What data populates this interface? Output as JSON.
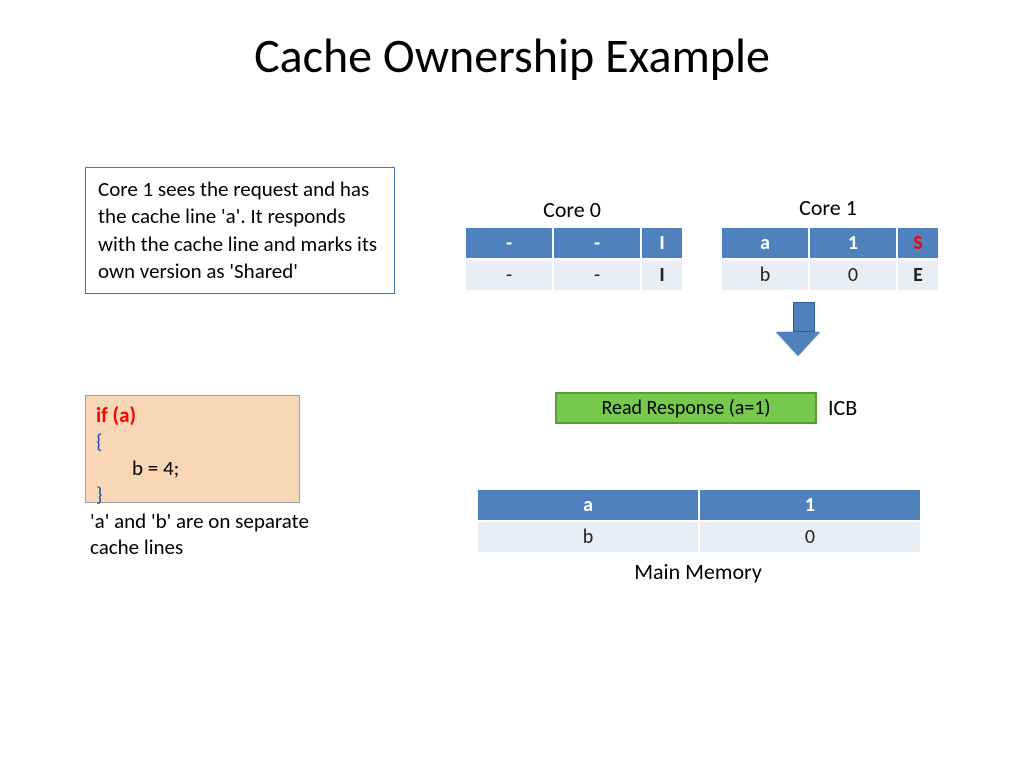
{
  "title": "Cache Ownership Example",
  "description": "Core 1 sees the request and has the cache line 'a'. It responds with the cache line and marks its own version as 'Shared'",
  "code": {
    "if_line": "if (a)",
    "open_brace": "{",
    "stmt": "b = 4;",
    "close_brace": "}"
  },
  "note": "'a' and 'b' are on separate cache lines",
  "core0": {
    "label": "Core 0",
    "row0": {
      "tag": "-",
      "data": "-",
      "state": "I"
    },
    "row1": {
      "tag": "-",
      "data": "-",
      "state": "I"
    }
  },
  "core1": {
    "label": "Core 1",
    "row0": {
      "tag": "a",
      "data": "1",
      "state": "S"
    },
    "row1": {
      "tag": "b",
      "data": "0",
      "state": "E"
    }
  },
  "icb": {
    "msg": "Read Response (a=1)",
    "label": "ICB"
  },
  "main_memory": {
    "label": "Main Memory",
    "rows": [
      {
        "key": "a",
        "val": "1"
      },
      {
        "key": "b",
        "val": "0"
      }
    ]
  }
}
